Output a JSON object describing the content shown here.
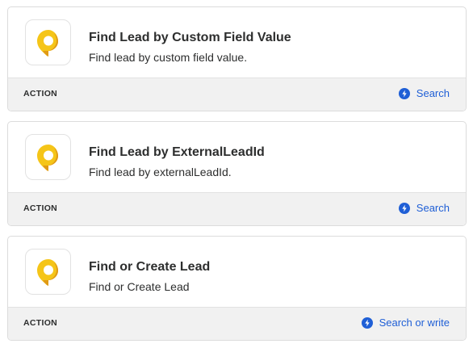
{
  "colors": {
    "accent": "#1f5fd6",
    "icon_yellow": "#f5c518",
    "icon_orange": "#e09a16",
    "footer_bg": "#f1f1f1"
  },
  "cards": [
    {
      "icon": "location-pin-icon",
      "title": "Find Lead by Custom Field Value",
      "description": "Find lead by custom field value.",
      "type_label": "ACTION",
      "action_icon": "bolt-icon",
      "action_label": "Search"
    },
    {
      "icon": "location-pin-icon",
      "title": "Find Lead by ExternalLeadId",
      "description": "Find lead by externalLeadId.",
      "type_label": "ACTION",
      "action_icon": "bolt-icon",
      "action_label": "Search"
    },
    {
      "icon": "location-pin-icon",
      "title": "Find or Create Lead",
      "description": "Find or Create Lead",
      "type_label": "ACTION",
      "action_icon": "bolt-icon",
      "action_label": "Search or write"
    }
  ]
}
